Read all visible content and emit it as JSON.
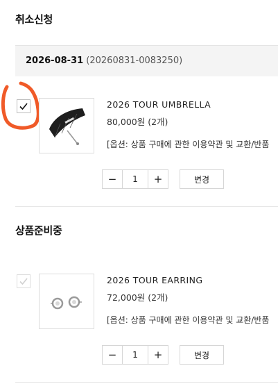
{
  "cancel_section": {
    "title": "취소신청",
    "order": {
      "date": "2026-08-31",
      "order_id": "(20260831-0083250)"
    },
    "item": {
      "checked": true,
      "name": "2026 TOUR UMBRELLA",
      "price": "80,000원 (2개)",
      "option": "[옵션: 상품 구매에 관한 이용약관 및 교환/반품",
      "quantity": "1",
      "minus_label": "−",
      "plus_label": "+",
      "change_label": "변경"
    }
  },
  "preparing_section": {
    "title": "상품준비중",
    "item": {
      "checked": true,
      "disabled": true,
      "name": "2026 TOUR EARRING",
      "price": "72,000원 (2개)",
      "option": "[옵션: 상품 구매에 관한 이용약관 및 교환/반품",
      "quantity": "1",
      "minus_label": "−",
      "plus_label": "+",
      "change_label": "변경"
    }
  },
  "annotation": {
    "color": "#f05a28",
    "shape": "hand-drawn circle around checkbox"
  }
}
